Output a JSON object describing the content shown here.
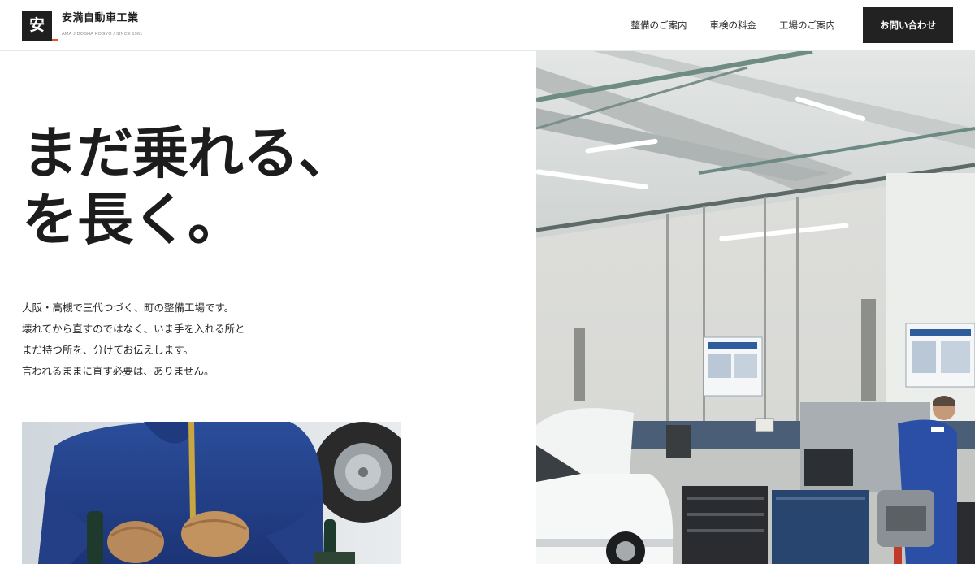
{
  "brand": {
    "mark": "安",
    "name": "安満自動車工業",
    "tagline": "AMA JIDOSHA KOGYO / SINCE 1961",
    "accent_color": "#e2582a"
  },
  "nav": {
    "items": [
      {
        "label": "整備のご案内"
      },
      {
        "label": "車検の料金"
      },
      {
        "label": "工場のご案内"
      }
    ],
    "contact_label": "お問い合わせ"
  },
  "hero": {
    "title_lines": [
      "まだ乗れる、",
      "を長く。"
    ],
    "description_lines": [
      "大阪・高槻で三代つづく、町の整備工場です。",
      "壊れてから直すのではなく、いま手を入れる所と",
      "まだ持つ所を、分けてお伝えします。",
      "言われるままに直す必要は、ありません。"
    ]
  },
  "colors": {
    "text": "#1c1c1c",
    "button_bg": "#222222",
    "header_border": "#e6e6e6"
  }
}
